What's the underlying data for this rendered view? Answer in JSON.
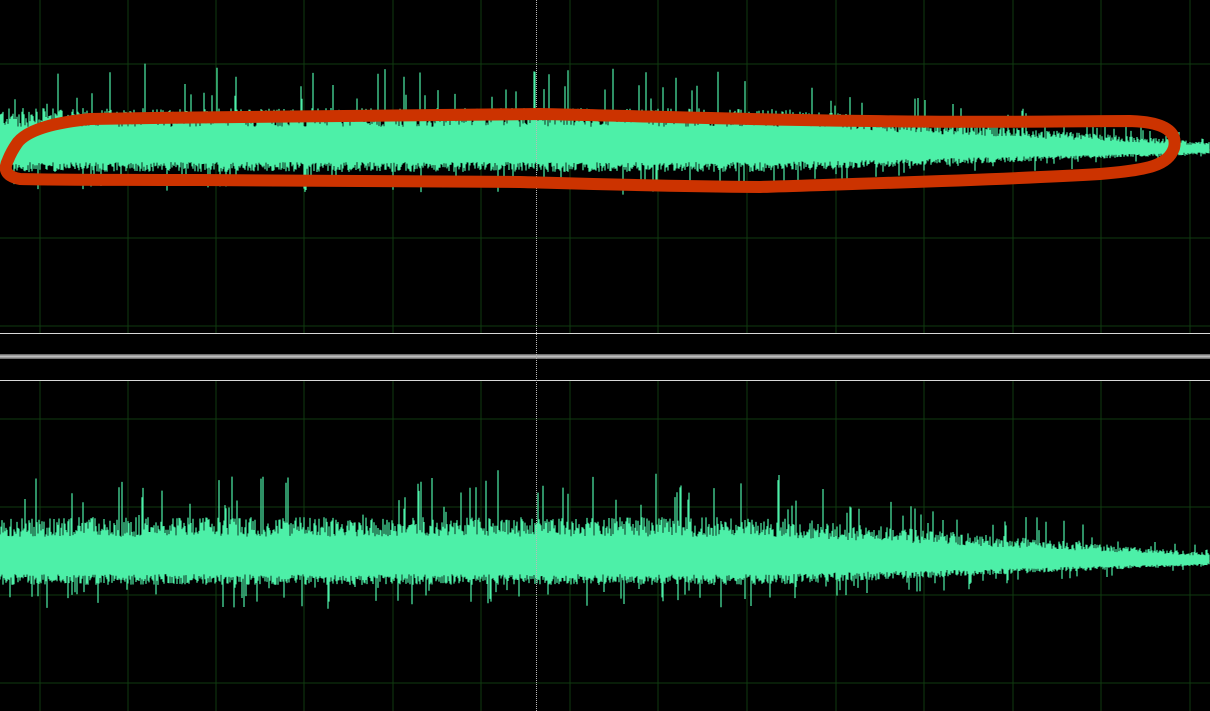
{
  "editor": {
    "view": "waveform",
    "channels": [
      {
        "id": "left"
      },
      {
        "id": "right"
      }
    ],
    "colors": {
      "background": "#000000",
      "grid": "#103a10",
      "waveform": "#4df0a8",
      "center_line": "#d01010",
      "divider": "#d8d8d8",
      "playhead": "#b8b8b8",
      "annotation": "#cc3300"
    },
    "grid": true,
    "playhead_marker": "dotted",
    "annotation": {
      "shape": "freehand-outline",
      "highlights": "channel-left"
    }
  }
}
